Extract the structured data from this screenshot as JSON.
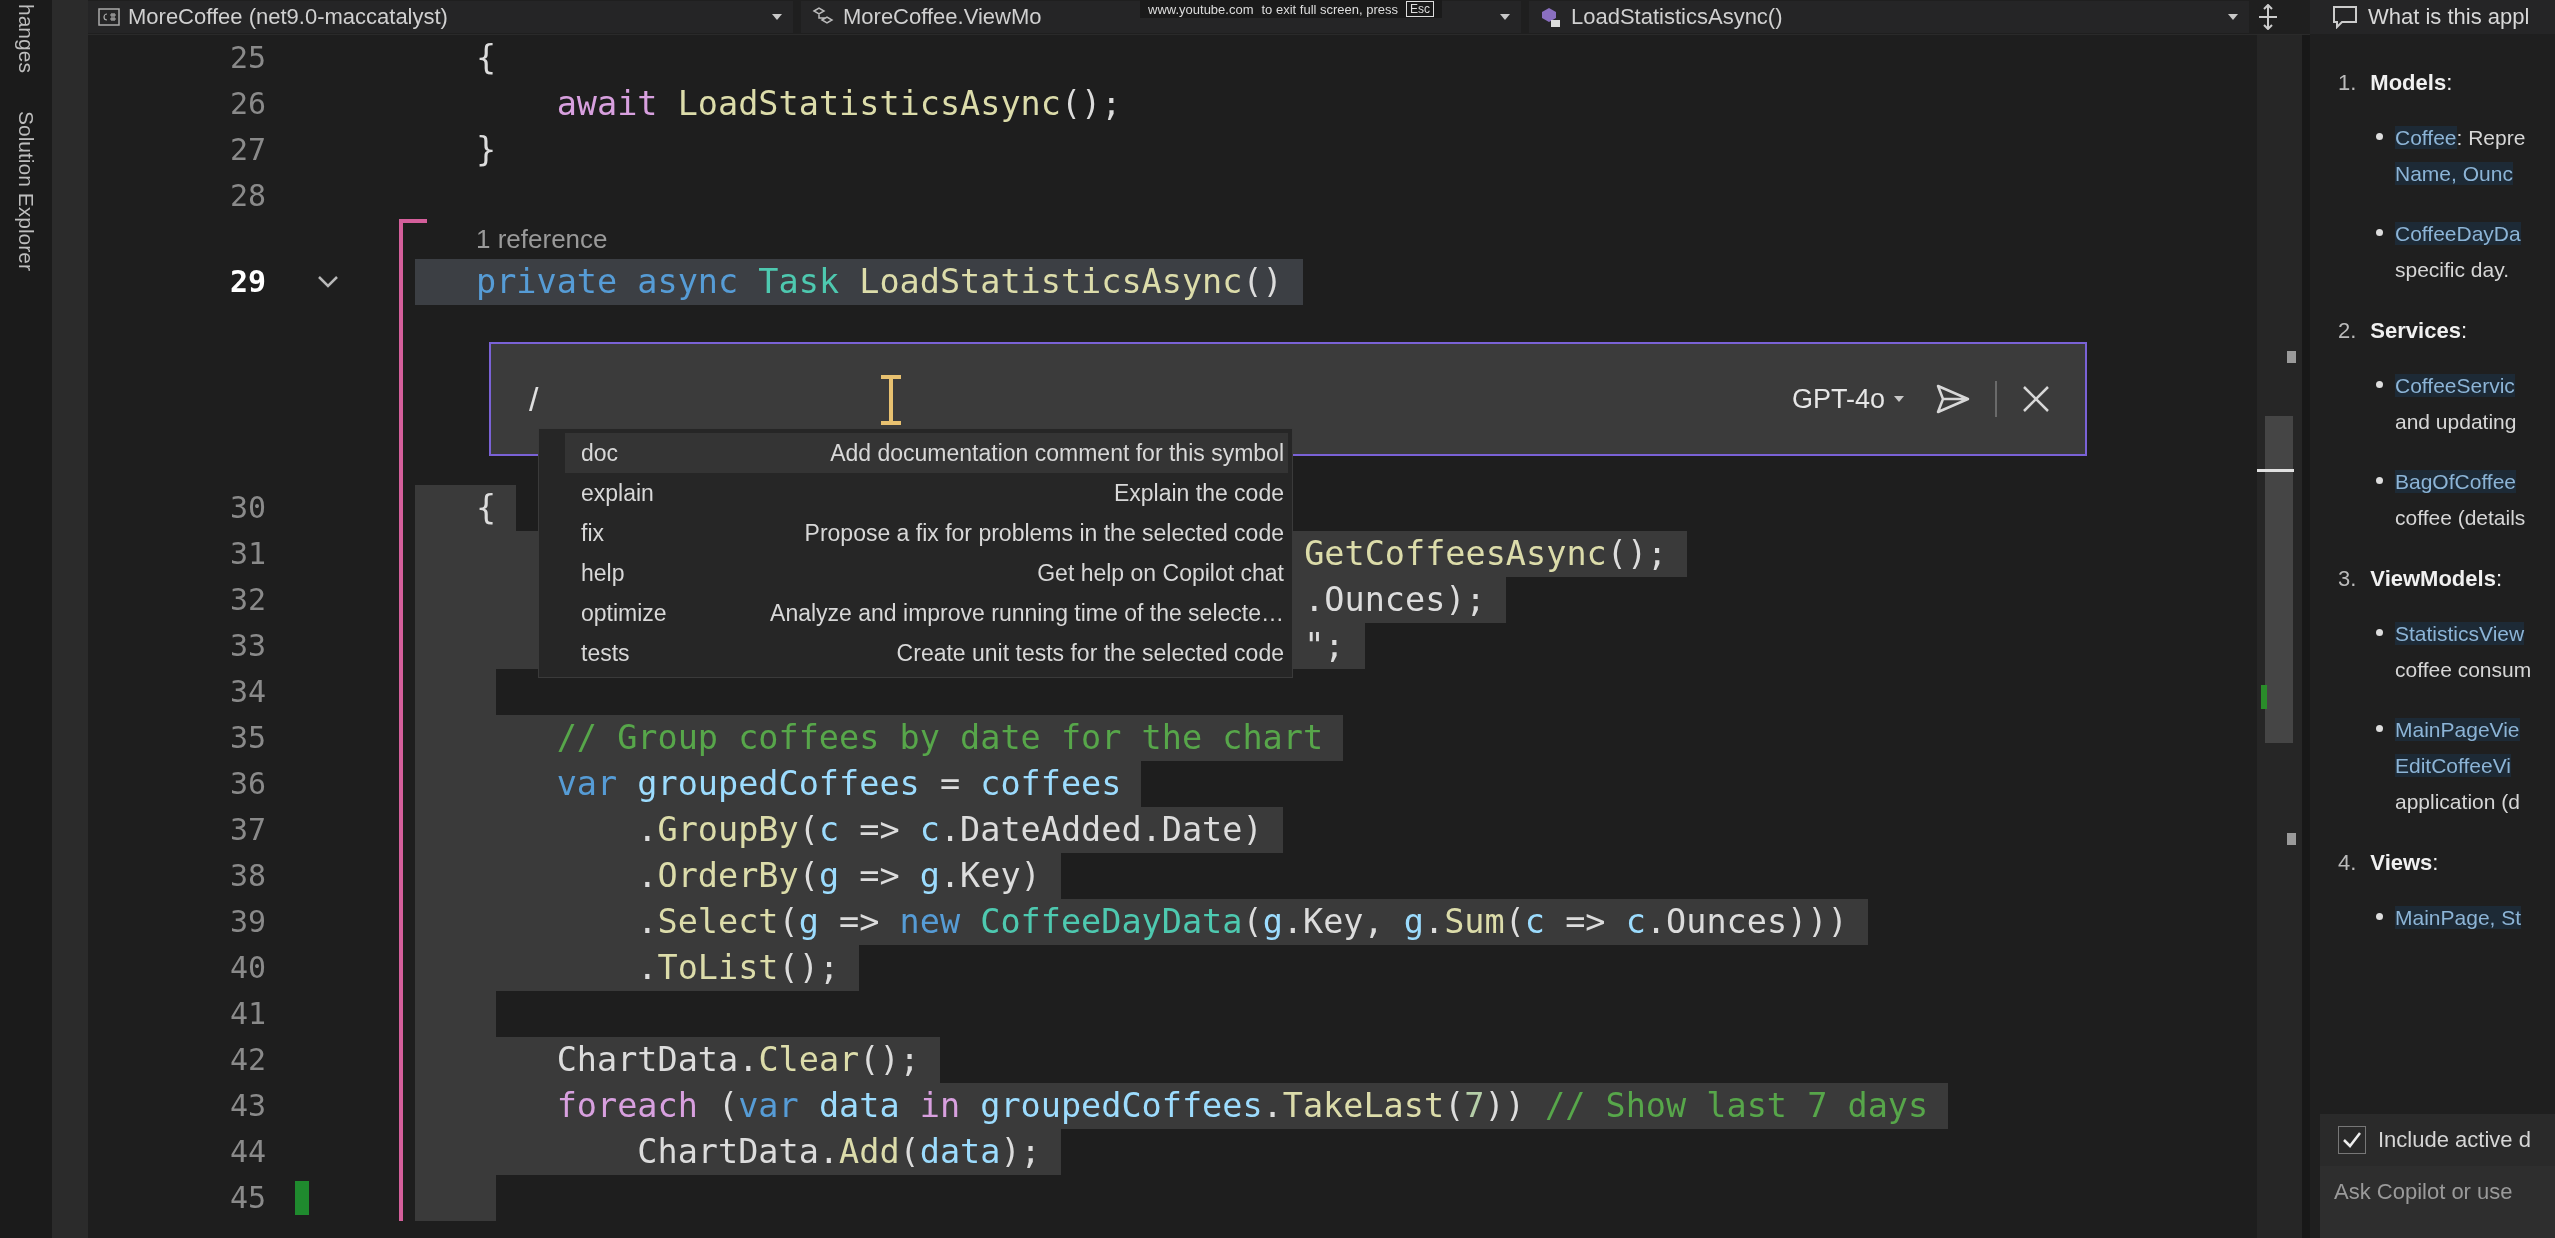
{
  "side_tabs": [
    {
      "label": "hanges"
    },
    {
      "label": "Solution Explorer"
    }
  ],
  "nav_bar": {
    "project": "MoreCoffee (net9.0-maccatalyst)",
    "type": "MoreCoffee.ViewMo",
    "member": "LoadStatisticsAsync()"
  },
  "fullscreen_notice": {
    "site": "www.youtube.com",
    "message": "to exit full screen, press",
    "key": "Esc"
  },
  "editor": {
    "lines": [
      {
        "kind": "code",
        "number": "25",
        "current": false,
        "foldable": false,
        "selected": false,
        "modified": false,
        "saved": false,
        "tokens": [
          {
            "text": "{",
            "kind": "plain"
          }
        ]
      },
      {
        "kind": "code",
        "number": "26",
        "current": false,
        "foldable": false,
        "selected": false,
        "modified": false,
        "saved": false,
        "tokens": [
          {
            "text": "    await",
            "kind": "control"
          },
          {
            "text": " LoadStatisticsAsync",
            "kind": "method"
          },
          {
            "text": "();",
            "kind": "plain"
          }
        ]
      },
      {
        "kind": "code",
        "number": "27",
        "current": false,
        "foldable": false,
        "selected": false,
        "modified": false,
        "saved": false,
        "tokens": [
          {
            "text": "}",
            "kind": "plain"
          }
        ]
      },
      {
        "kind": "code",
        "number": "28",
        "current": false,
        "foldable": false,
        "selected": false,
        "modified": false,
        "saved": false
      },
      {
        "kind": "codelens",
        "text": "1 reference",
        "modified": true
      },
      {
        "kind": "code",
        "number": "29",
        "current": true,
        "foldable": true,
        "selected": true,
        "modified": true,
        "saved": false,
        "tokens": [
          {
            "text": "private",
            "kind": "keyword"
          },
          {
            "text": " async",
            "kind": "keyword"
          },
          {
            "text": " Task",
            "kind": "type"
          },
          {
            "text": " LoadStatisticsAsync",
            "kind": "method"
          },
          {
            "text": "()",
            "kind": "plain"
          }
        ]
      },
      {
        "kind": "inline_chat",
        "modified": true
      },
      {
        "kind": "code",
        "number": "30",
        "current": false,
        "foldable": false,
        "selected": true,
        "modified": true,
        "saved": false,
        "tokens": [
          {
            "text": "{",
            "kind": "plain"
          }
        ]
      },
      {
        "kind": "covered",
        "number": "31",
        "current": false,
        "foldable": false,
        "selected": true,
        "modified": true,
        "saved": false,
        "tokens": [
          {
            "text": "GetCoffeesAsync",
            "kind": "method"
          },
          {
            "text": "();",
            "kind": "plain"
          }
        ]
      },
      {
        "kind": "covered",
        "number": "32",
        "current": false,
        "foldable": false,
        "selected": true,
        "modified": true,
        "saved": false,
        "tokens": [
          {
            "text": ".Ounces);",
            "kind": "plain"
          }
        ]
      },
      {
        "kind": "covered",
        "number": "33",
        "current": false,
        "foldable": false,
        "selected": true,
        "modified": true,
        "saved": false,
        "tokens": [
          {
            "text": "\";",
            "kind": "plain"
          }
        ]
      },
      {
        "kind": "code",
        "number": "34",
        "current": false,
        "foldable": false,
        "selected": true,
        "modified": true,
        "saved": false
      },
      {
        "kind": "code",
        "number": "35",
        "current": false,
        "foldable": false,
        "selected": true,
        "modified": true,
        "saved": false,
        "tokens": [
          {
            "text": "    // Group coffees by date for the chart",
            "kind": "comment"
          }
        ]
      },
      {
        "kind": "code",
        "number": "36",
        "current": false,
        "foldable": false,
        "selected": true,
        "modified": true,
        "saved": false,
        "tokens": [
          {
            "text": "    var",
            "kind": "keyword"
          },
          {
            "text": " groupedCoffees",
            "kind": "variable"
          },
          {
            "text": " = ",
            "kind": "plain"
          },
          {
            "text": "coffees",
            "kind": "variable"
          }
        ]
      },
      {
        "kind": "code",
        "number": "37",
        "current": false,
        "foldable": false,
        "selected": true,
        "modified": true,
        "saved": false,
        "tokens": [
          {
            "text": "        .",
            "kind": "plain"
          },
          {
            "text": "GroupBy",
            "kind": "method"
          },
          {
            "text": "(",
            "kind": "plain"
          },
          {
            "text": "c",
            "kind": "variable"
          },
          {
            "text": " => ",
            "kind": "plain"
          },
          {
            "text": "c",
            "kind": "variable"
          },
          {
            "text": ".DateAdded.Date)",
            "kind": "plain"
          }
        ]
      },
      {
        "kind": "code",
        "number": "38",
        "current": false,
        "foldable": false,
        "selected": true,
        "modified": true,
        "saved": false,
        "tokens": [
          {
            "text": "        .",
            "kind": "plain"
          },
          {
            "text": "OrderBy",
            "kind": "method"
          },
          {
            "text": "(",
            "kind": "plain"
          },
          {
            "text": "g",
            "kind": "variable"
          },
          {
            "text": " => ",
            "kind": "plain"
          },
          {
            "text": "g",
            "kind": "variable"
          },
          {
            "text": ".Key)",
            "kind": "plain"
          }
        ]
      },
      {
        "kind": "code",
        "number": "39",
        "current": false,
        "foldable": false,
        "selected": true,
        "modified": true,
        "saved": false,
        "tokens": [
          {
            "text": "        .",
            "kind": "plain"
          },
          {
            "text": "Select",
            "kind": "method"
          },
          {
            "text": "(",
            "kind": "plain"
          },
          {
            "text": "g",
            "kind": "variable"
          },
          {
            "text": " => ",
            "kind": "plain"
          },
          {
            "text": "new",
            "kind": "keyword"
          },
          {
            "text": " CoffeeDayData",
            "kind": "type"
          },
          {
            "text": "(",
            "kind": "plain"
          },
          {
            "text": "g",
            "kind": "variable"
          },
          {
            "text": ".Key, ",
            "kind": "plain"
          },
          {
            "text": "g",
            "kind": "variable"
          },
          {
            "text": ".",
            "kind": "plain"
          },
          {
            "text": "Sum",
            "kind": "method"
          },
          {
            "text": "(",
            "kind": "plain"
          },
          {
            "text": "c",
            "kind": "variable"
          },
          {
            "text": " => ",
            "kind": "plain"
          },
          {
            "text": "c",
            "kind": "variable"
          },
          {
            "text": ".Ounces)))",
            "kind": "plain"
          }
        ]
      },
      {
        "kind": "code",
        "number": "40",
        "current": false,
        "foldable": false,
        "selected": true,
        "modified": true,
        "saved": false,
        "tokens": [
          {
            "text": "        .",
            "kind": "plain"
          },
          {
            "text": "ToList",
            "kind": "method"
          },
          {
            "text": "();",
            "kind": "plain"
          }
        ]
      },
      {
        "kind": "code",
        "number": "41",
        "current": false,
        "foldable": false,
        "selected": true,
        "modified": true,
        "saved": false
      },
      {
        "kind": "code",
        "number": "42",
        "current": false,
        "foldable": false,
        "selected": true,
        "modified": true,
        "saved": false,
        "tokens": [
          {
            "text": "    ChartData.",
            "kind": "plain"
          },
          {
            "text": "Clear",
            "kind": "method"
          },
          {
            "text": "();",
            "kind": "plain"
          }
        ]
      },
      {
        "kind": "code",
        "number": "43",
        "current": false,
        "foldable": false,
        "selected": true,
        "modified": true,
        "saved": false,
        "tokens": [
          {
            "text": "    foreach",
            "kind": "control"
          },
          {
            "text": " (",
            "kind": "plain"
          },
          {
            "text": "var",
            "kind": "keyword"
          },
          {
            "text": " data",
            "kind": "variable"
          },
          {
            "text": " in",
            "kind": "control"
          },
          {
            "text": " groupedCoffees",
            "kind": "variable"
          },
          {
            "text": ".",
            "kind": "plain"
          },
          {
            "text": "TakeLast",
            "kind": "method"
          },
          {
            "text": "(",
            "kind": "plain"
          },
          {
            "text": "7",
            "kind": "number"
          },
          {
            "text": ")) ",
            "kind": "plain"
          },
          {
            "text": "// Show last 7 days",
            "kind": "comment"
          }
        ]
      },
      {
        "kind": "code",
        "number": "44",
        "current": false,
        "foldable": false,
        "selected": true,
        "modified": true,
        "saved": false,
        "tokens": [
          {
            "text": "        ChartData.",
            "kind": "plain"
          },
          {
            "text": "Add",
            "kind": "method"
          },
          {
            "text": "(",
            "kind": "plain"
          },
          {
            "text": "data",
            "kind": "variable"
          },
          {
            "text": ");",
            "kind": "plain"
          }
        ]
      },
      {
        "kind": "code",
        "number": "45",
        "current": false,
        "foldable": false,
        "selected": true,
        "modified": true,
        "saved": true
      }
    ]
  },
  "inline_chat": {
    "value": "/",
    "model": "GPT-4o",
    "commands": [
      {
        "name": "doc",
        "description": "Add documentation comment for this symbol",
        "selected": true
      },
      {
        "name": "explain",
        "description": "Explain the code",
        "selected": false
      },
      {
        "name": "fix",
        "description": "Propose a fix for problems in the selected code",
        "selected": false
      },
      {
        "name": "help",
        "description": "Get help on Copilot chat",
        "selected": false
      },
      {
        "name": "optimize",
        "description": "Analyze and improve running time of the selecte…",
        "selected": false
      },
      {
        "name": "tests",
        "description": "Create unit tests for the selected code",
        "selected": false
      }
    ]
  },
  "chat": {
    "title": "What is this appl",
    "sections": [
      {
        "number": "1.",
        "heading": "**Models**:",
        "items": [
          {
            "lines": [
              [
                {
                  "text": "Coffee",
                  "link": true
                },
                {
                  "text": ": Repre",
                  "link": false
                }
              ],
              [
                {
                  "text": "Name, Ounc",
                  "link": true
                }
              ]
            ]
          },
          {
            "lines": [
              [
                {
                  "text": "CoffeeDayDa",
                  "link": true
                }
              ],
              [
                {
                  "text": "specific day.",
                  "link": false
                }
              ]
            ]
          }
        ]
      },
      {
        "number": "2.",
        "heading": "**Services**:",
        "items": [
          {
            "lines": [
              [
                {
                  "text": "CoffeeServic",
                  "link": true
                }
              ],
              [
                {
                  "text": "and updating",
                  "link": false
                }
              ]
            ]
          },
          {
            "lines": [
              [
                {
                  "text": "BagOfCoffee",
                  "link": true
                }
              ],
              [
                {
                  "text": "coffee (details",
                  "link": false
                }
              ]
            ]
          }
        ]
      },
      {
        "number": "3.",
        "heading": "**ViewModels**:",
        "items": [
          {
            "lines": [
              [
                {
                  "text": "StatisticsView",
                  "link": true
                }
              ],
              [
                {
                  "text": "coffee consum",
                  "link": false
                }
              ]
            ]
          },
          {
            "lines": [
              [
                {
                  "text": "MainPageVie",
                  "link": true
                }
              ],
              [
                {
                  "text": "EditCoffeeVi",
                  "link": true
                }
              ],
              [
                {
                  "text": "application (d",
                  "link": false
                }
              ]
            ]
          }
        ]
      },
      {
        "number": "4.",
        "heading": "**Views**:",
        "items": [
          {
            "lines": [
              [
                {
                  "text": "MainPage, St",
                  "link": true
                }
              ]
            ]
          }
        ]
      }
    ],
    "include_active": {
      "label": "Include active d",
      "checked": true
    },
    "input": {
      "placeholder": "Ask Copilot or use"
    }
  }
}
